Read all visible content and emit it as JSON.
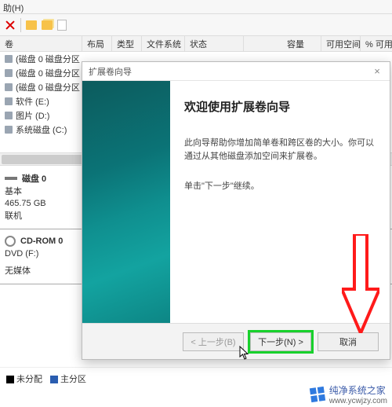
{
  "menu": {
    "help": "助(H)"
  },
  "columns": {
    "volume": "卷",
    "layout": "布局",
    "type": "类型",
    "filesystem": "文件系统",
    "status": "状态",
    "capacity": "容量",
    "free": "可用空间",
    "percent": "% 可用"
  },
  "volumes": [
    {
      "label": "(磁盘 0 磁盘分区"
    },
    {
      "label": "(磁盘 0 磁盘分区"
    },
    {
      "label": "(磁盘 0 磁盘分区"
    },
    {
      "label": "软件 (E:)"
    },
    {
      "label": "图片 (D:)"
    },
    {
      "label": "系统磁盘 (C:)"
    }
  ],
  "disks": {
    "disk0": {
      "title": "磁盘 0",
      "kind": "基本",
      "size": "465.75 GB",
      "status": "联机"
    },
    "cdrom": {
      "title": "CD-ROM 0",
      "kind": "DVD (F:)",
      "status": "无媒体"
    }
  },
  "legend": {
    "unallocated": "未分配",
    "primary": "主分区"
  },
  "wizard": {
    "window_title": "扩展卷向导",
    "heading": "欢迎使用扩展卷向导",
    "desc": "此向导帮助你增加简单卷和跨区卷的大小。你可以通过从其他磁盘添加空间来扩展卷。",
    "instruction": "单击\"下一步\"继续。",
    "buttons": {
      "back": "< 上一步(B)",
      "next": "下一步(N) >",
      "cancel": "取消"
    }
  },
  "watermark": {
    "name": "纯净系统之家",
    "url": "www.ycwjzy.com"
  }
}
